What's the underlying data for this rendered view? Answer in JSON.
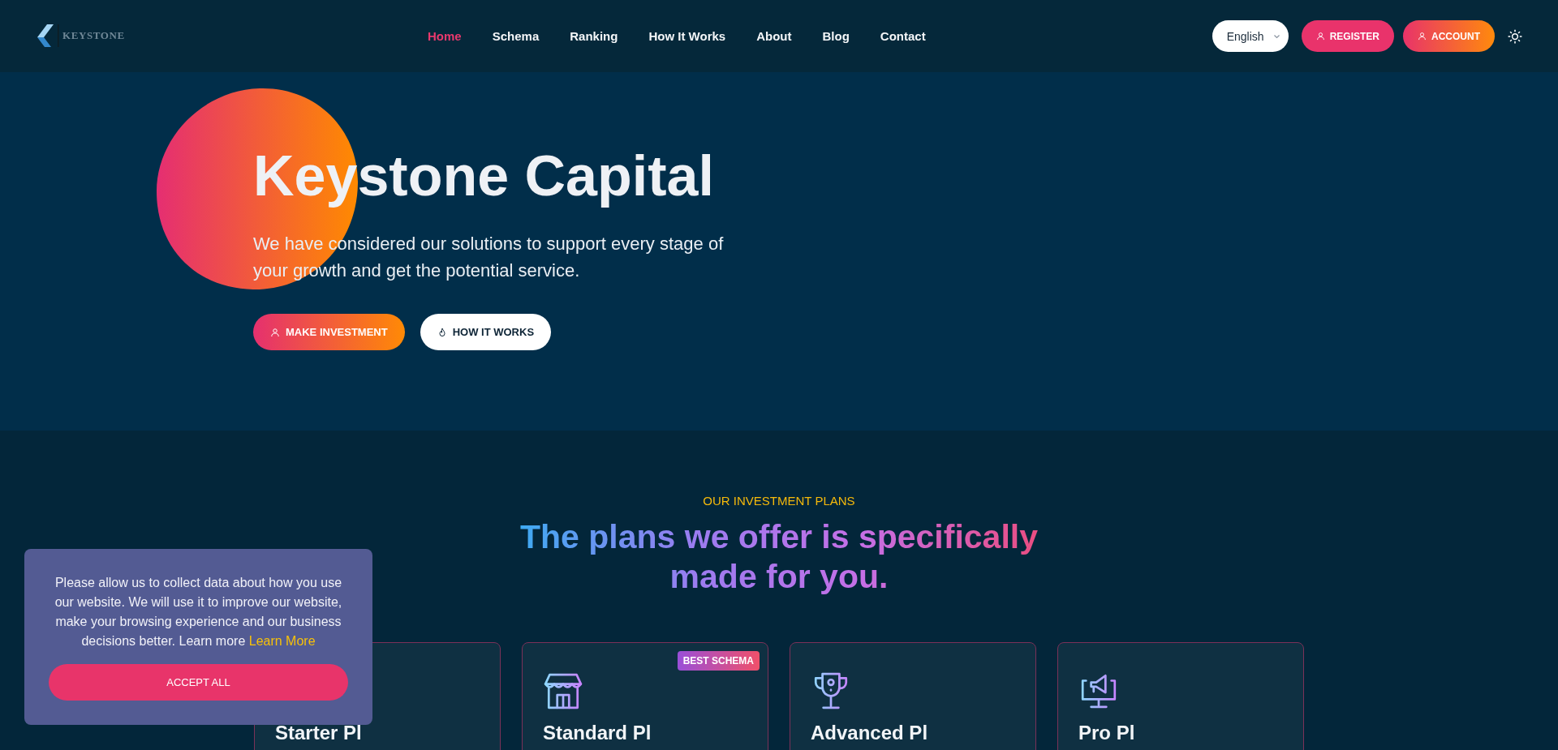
{
  "header": {
    "logo": {
      "text": "KEYSTONE"
    },
    "nav": [
      {
        "label": "Home",
        "selected": true
      },
      {
        "label": "Schema",
        "selected": false
      },
      {
        "label": "Ranking",
        "selected": false
      },
      {
        "label": "How It Works",
        "selected": false
      },
      {
        "label": "About",
        "selected": false
      },
      {
        "label": "Blog",
        "selected": false
      },
      {
        "label": "Contact",
        "selected": false
      }
    ],
    "language": {
      "value": "English"
    },
    "buttons": [
      {
        "label": "REGISTER",
        "kind": "solid"
      },
      {
        "label": "ACCOUNT",
        "kind": "gradient"
      }
    ]
  },
  "hero": {
    "title": "Keystone Capital",
    "subtitle": "We have considered our solutions to support every stage of your growth and get the potential service.",
    "buttons": [
      {
        "label": "MAKE INVESTMENT",
        "kind": "primary"
      },
      {
        "label": "HOW IT WORKS",
        "kind": "secondary"
      }
    ]
  },
  "plans": {
    "eyebrow": "OUR INVESTMENT PLANS",
    "heading": "The plans we offer is specifically made for you.",
    "cards": [
      {
        "title": "Starter Pl"
      },
      {
        "title": "Standard Pl",
        "badge": "BEST SCHEMA"
      },
      {
        "title": "Advanced Pl"
      },
      {
        "title": "Pro Pl"
      }
    ]
  },
  "cookie_banner": {
    "text": "Please allow us to collect data about how you use our website. We will use it to improve our website, make your browsing experience and our business decisions better. Learn more",
    "link": "Learn More",
    "button": "ACCEPT ALL"
  }
}
